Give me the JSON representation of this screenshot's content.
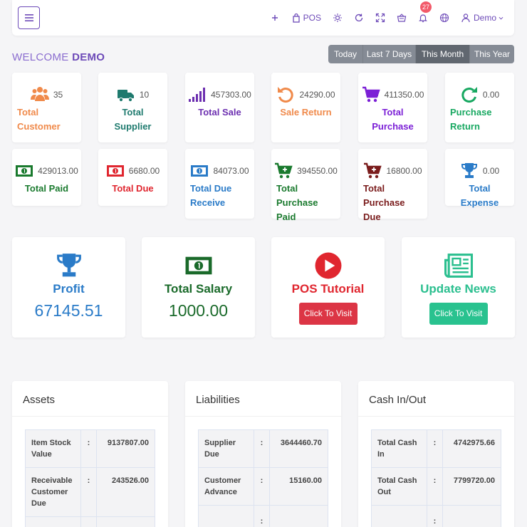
{
  "topbar": {
    "menu_icon": "hamburger-icon",
    "pos_label": "POS",
    "notification_count": "27",
    "user_name": "Demo"
  },
  "welcome": {
    "prefix": "WELCOME",
    "name": "DEMO"
  },
  "range": [
    "Today",
    "Last 7 Days",
    "This Month",
    "This Year"
  ],
  "range_active": "This Month",
  "cards_row1": [
    {
      "value": "35",
      "label": "Total Customer",
      "color": "#f08a4b",
      "icon": "users-icon"
    },
    {
      "value": "10",
      "label": "Total Supplier",
      "color": "#1e7a6e",
      "icon": "truck-icon"
    },
    {
      "value": "457303.00",
      "label": "Total Sale",
      "color": "#6c2fb0",
      "icon": "bar-signal-icon"
    },
    {
      "value": "24290.00",
      "label": "Sale Return",
      "color": "#f08a4b",
      "icon": "undo-icon"
    },
    {
      "value": "411350.00",
      "label": "Total Purchase",
      "color": "#7b1fd6",
      "icon": "cart-icon"
    },
    {
      "value": "0.00",
      "label": "Purchase Return",
      "color": "#18a861",
      "icon": "redo-icon"
    }
  ],
  "cards_row2": [
    {
      "value": "429013.00",
      "label": "Total Paid",
      "color": "#1a7a2e",
      "icon": "money-icon"
    },
    {
      "value": "6680.00",
      "label": "Total Due",
      "color": "#e0262f",
      "icon": "money-icon"
    },
    {
      "value": "84073.00",
      "label": "Total Due Receive",
      "color": "#2a7bc8",
      "icon": "money-icon"
    },
    {
      "value": "394550.00",
      "label": "Total Purchase Paid",
      "color": "#1a7a2e",
      "icon": "cart-plus-icon"
    },
    {
      "value": "16800.00",
      "label": "Total Purchase Due",
      "color": "#7a1c1c",
      "icon": "cart-plus-icon"
    },
    {
      "value": "0.00",
      "label": "Total Expense",
      "color": "#2a7bc8",
      "icon": "trophy-icon"
    }
  ],
  "big": {
    "profit": {
      "title": "Profit",
      "value": "67145.51",
      "color": "#2a7bc8"
    },
    "salary": {
      "title": "Total Salary",
      "value": "1000.00",
      "color": "#1a6a2a"
    },
    "tutorial": {
      "title": "POS Tutorial",
      "button": "Click To Visit",
      "color": "#e0262f"
    },
    "news": {
      "title": "Update News",
      "button": "Click To Visit",
      "color": "#2bbf8f"
    }
  },
  "panels": {
    "assets": {
      "title": "Assets",
      "rows": [
        {
          "label": "Item Stock Value",
          "sep": ":",
          "value": "9137807.00"
        },
        {
          "label": "Receivable Customer Due",
          "sep": ":",
          "value": "243526.00"
        },
        {
          "label": "",
          "sep": "",
          "value": ""
        }
      ]
    },
    "liabilities": {
      "title": "Liabilities",
      "rows": [
        {
          "label": "Supplier Due",
          "sep": ":",
          "value": "3644460.70"
        },
        {
          "label": "Customer Advance",
          "sep": ":",
          "value": "15160.00"
        },
        {
          "label": "",
          "sep": ":",
          "value": ""
        }
      ]
    },
    "cash": {
      "title": "Cash In/Out",
      "rows": [
        {
          "label": "Total Cash In",
          "sep": ":",
          "value": "4742975.66"
        },
        {
          "label": "Total Cash Out",
          "sep": ":",
          "value": "7799720.00"
        },
        {
          "label": "",
          "sep": ":",
          "value": ""
        }
      ]
    }
  }
}
